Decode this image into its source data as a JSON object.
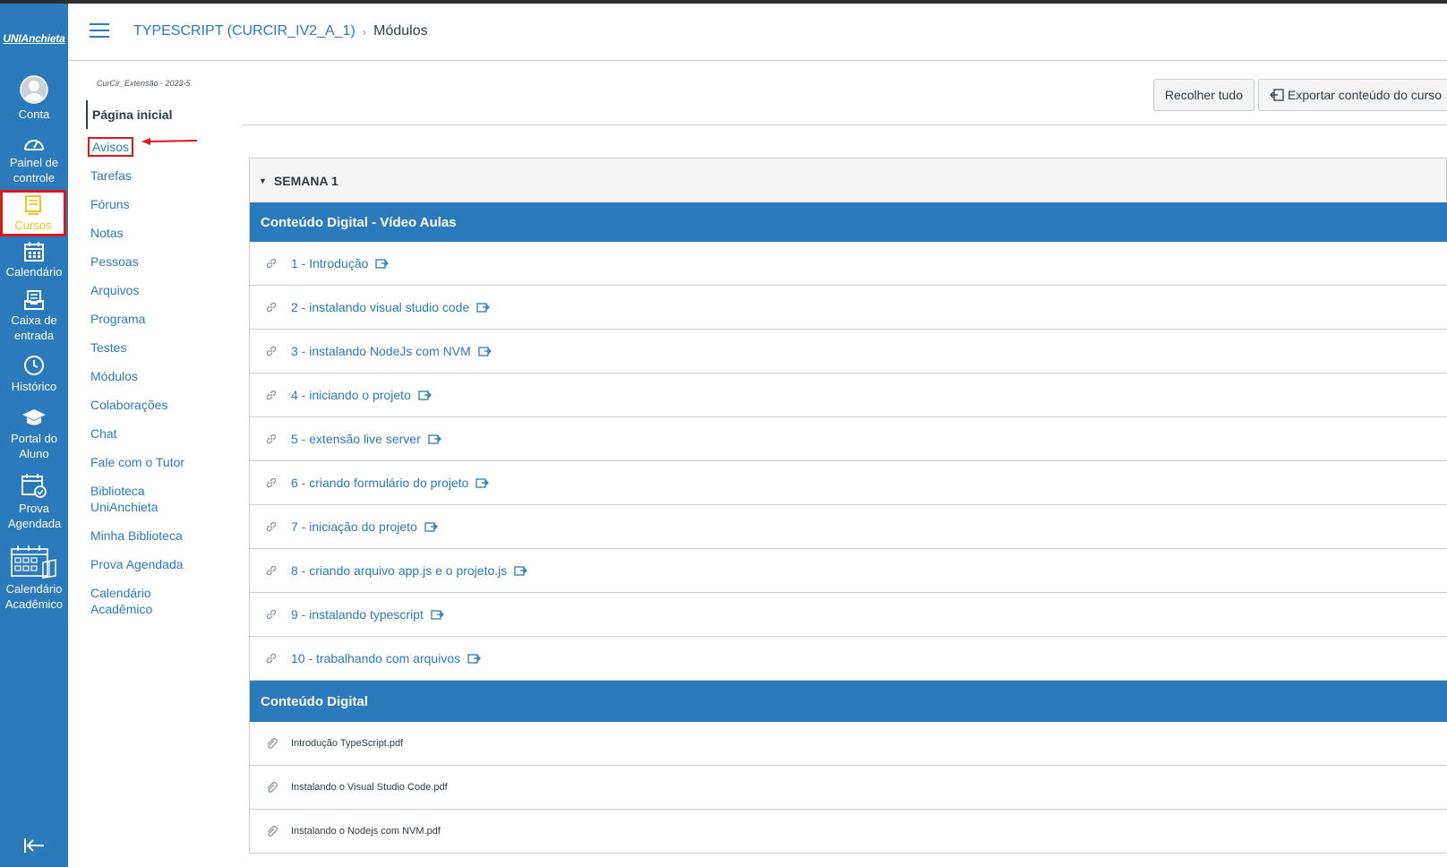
{
  "global_nav": {
    "logo_text": "UNIAnchieta",
    "items": [
      {
        "label": "Conta"
      },
      {
        "label": "Painel de controle"
      },
      {
        "label": "Cursos"
      },
      {
        "label": "Calendário"
      },
      {
        "label": "Caixa de entrada"
      },
      {
        "label": "Histórico"
      },
      {
        "label": "Portal do Aluno"
      },
      {
        "label": "Prova Agendada"
      },
      {
        "label": "Calendário Acadêmico"
      }
    ]
  },
  "header": {
    "course": "TYPESCRIPT (CURCIR_IV2_A_1)",
    "separator": "›",
    "current": "Módulos"
  },
  "course_nav": {
    "term": "CurCir_Extensão - 2023-5",
    "items": [
      {
        "label": "Página inicial"
      },
      {
        "label": "Avisos"
      },
      {
        "label": "Tarefas"
      },
      {
        "label": "Fóruns"
      },
      {
        "label": "Notas"
      },
      {
        "label": "Pessoas"
      },
      {
        "label": "Arquivos"
      },
      {
        "label": "Programa"
      },
      {
        "label": "Testes"
      },
      {
        "label": "Módulos"
      },
      {
        "label": "Colaborações"
      },
      {
        "label": "Chat"
      },
      {
        "label": "Fale com o Tutor"
      },
      {
        "label": "Biblioteca UniAnchieta"
      },
      {
        "label": "Minha Biblioteca"
      },
      {
        "label": "Prova Agendada"
      },
      {
        "label": "Calendário Acadêmico"
      }
    ]
  },
  "toolbar": {
    "collapse_label": "Recolher tudo",
    "export_label": "Exportar conteúdo do curso"
  },
  "module": {
    "title": "SEMANA 1",
    "sections": [
      {
        "title": "Conteúdo Digital - Vídeo Aulas",
        "items": [
          "1 - Introdução",
          "2 - instalando visual studio code",
          "3 - instalando NodeJs com NVM",
          "4 - iniciando o projeto",
          "5 - extensão live server",
          "6 - criando formulário do projeto",
          "7 - iniciação do projeto",
          "8 - criando arquivo app.js e o projeto.js",
          "9 - instalando typescript",
          "10 - trabalhando com arquivos"
        ]
      },
      {
        "title": "Conteúdo Digital",
        "items": [
          "Introdução TypeScript.pdf",
          "Instalando o Visual Studio Code.pdf",
          "Instalando o Nodejs com NVM.pdf"
        ]
      }
    ]
  }
}
